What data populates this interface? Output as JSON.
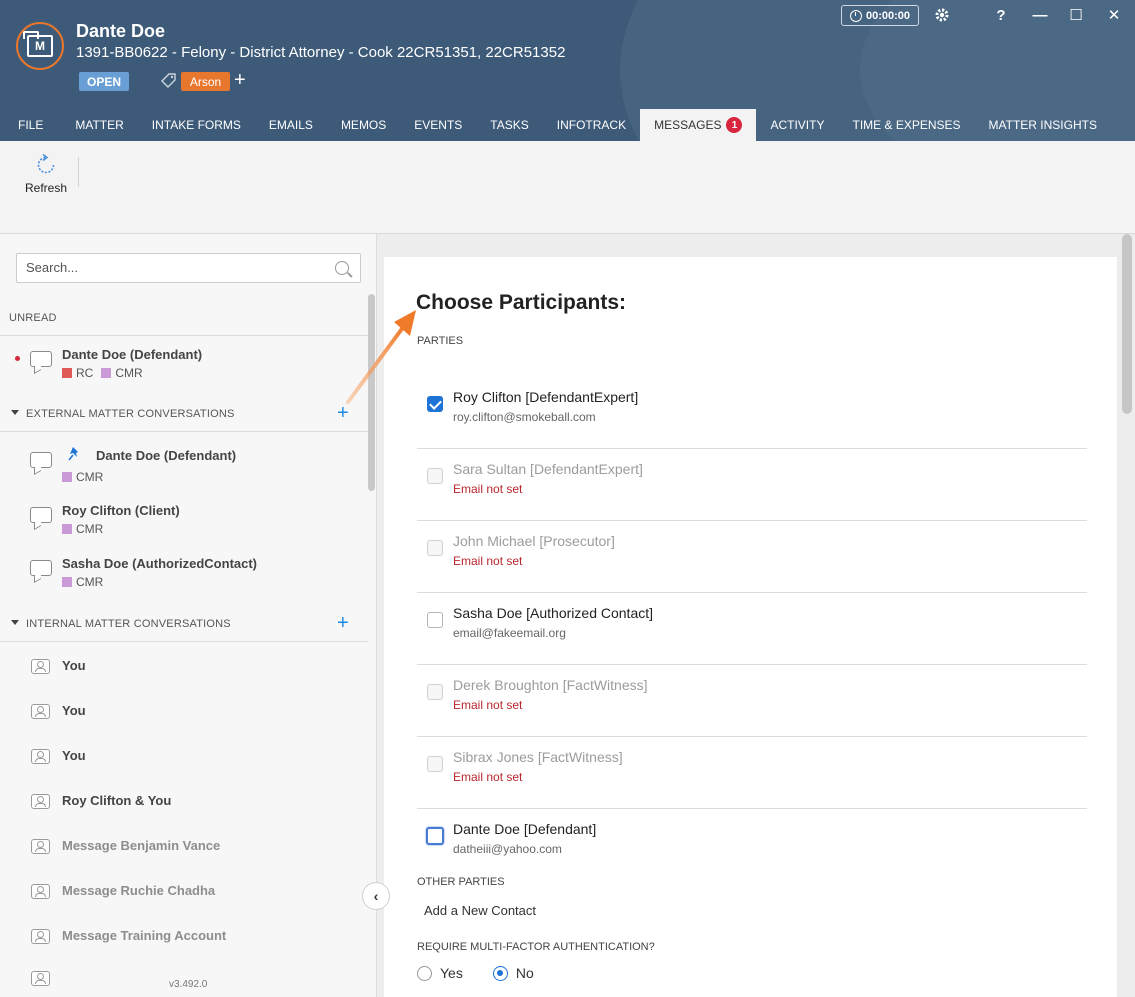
{
  "header": {
    "client_name": "Dante Doe",
    "matter_line": "1391-BB0622 - Felony - District Attorney - Cook 22CR51351, 22CR51352",
    "status": "OPEN",
    "tag": "Arson",
    "timer": "00:00:00",
    "icons": {
      "logo": "matter-logo",
      "tag": "tag-icon",
      "add": "plus-icon",
      "clock": "clock-icon",
      "settings": "gear-icon"
    }
  },
  "window_controls": {
    "help": "?",
    "minimize": "—",
    "maximize": "☐",
    "close": "✕"
  },
  "tabs": [
    {
      "label": "FILE"
    },
    {
      "label": "MATTER"
    },
    {
      "label": "INTAKE FORMS"
    },
    {
      "label": "EMAILS"
    },
    {
      "label": "MEMOS"
    },
    {
      "label": "EVENTS"
    },
    {
      "label": "TASKS"
    },
    {
      "label": "INFOTRACK"
    },
    {
      "label": "MESSAGES",
      "count": "1",
      "active": true
    },
    {
      "label": "ACTIVITY"
    },
    {
      "label": "TIME & EXPENSES"
    },
    {
      "label": "MATTER INSIGHTS"
    }
  ],
  "ribbon": {
    "refresh_label": "Refresh"
  },
  "sidebar": {
    "search_placeholder": "Search...",
    "unread_label": "UNREAD",
    "unread_conversation": {
      "title": "Dante Doe (Defendant)",
      "tags": [
        {
          "label": "RC",
          "color": "#e05a5a"
        },
        {
          "label": "CMR",
          "color": "#c99ad6"
        }
      ]
    },
    "external_label": "EXTERNAL MATTER CONVERSATIONS",
    "external_conversations": [
      {
        "title": "Dante Doe (Defendant)",
        "pinned": true,
        "tag": "CMR"
      },
      {
        "title": "Roy Clifton (Client)",
        "tag": "CMR"
      },
      {
        "title": "Sasha Doe (AuthorizedContact)",
        "tag": "CMR"
      }
    ],
    "tag_color": "#c99ad6",
    "internal_label": "INTERNAL MATTER CONVERSATIONS",
    "internal_conversations": [
      {
        "title": "You"
      },
      {
        "title": "You"
      },
      {
        "title": "You"
      },
      {
        "title": "Roy Clifton & You"
      },
      {
        "title": "Message Benjamin Vance"
      },
      {
        "title": "Message Ruchie Chadha"
      },
      {
        "title": "Message Training Account"
      }
    ],
    "version": "v3.492.0"
  },
  "participants": {
    "title": "Choose Participants:",
    "parties_label": "PARTIES",
    "parties": [
      {
        "name": "Roy Clifton [DefendantExpert]",
        "email": "roy.clifton@smokeball.com",
        "checked": true,
        "disabled": false
      },
      {
        "name": "Sara Sultan [DefendantExpert]",
        "email": "Email not set",
        "checked": false,
        "disabled": true
      },
      {
        "name": "John Michael [Prosecutor]",
        "email": "Email not set",
        "checked": false,
        "disabled": true
      },
      {
        "name": "Sasha Doe [Authorized Contact]",
        "email": "email@fakeemail.org",
        "checked": false,
        "disabled": false
      },
      {
        "name": "Derek Broughton [FactWitness]",
        "email": "Email not set",
        "checked": false,
        "disabled": true
      },
      {
        "name": "Sibrax Jones [FactWitness]",
        "email": "Email not set",
        "checked": false,
        "disabled": true
      },
      {
        "name": "Dante Doe [Defendant]",
        "email": "datheiii@yahoo.com",
        "checked": false,
        "disabled": false,
        "focused": true
      }
    ],
    "other_label": "OTHER PARTIES",
    "add_contact": "Add a New Contact",
    "mfa_label": "REQUIRE MULTI-FACTOR AUTHENTICATION?",
    "mfa_options": [
      {
        "label": "Yes",
        "selected": false
      },
      {
        "label": "No",
        "selected": true
      }
    ]
  },
  "colors": {
    "header": "#3d5a78",
    "accent": "#e8772e",
    "status": "#6a9fd6",
    "primary": "#1e73d6",
    "error": "#b8272d",
    "badge": "#d7263d"
  }
}
